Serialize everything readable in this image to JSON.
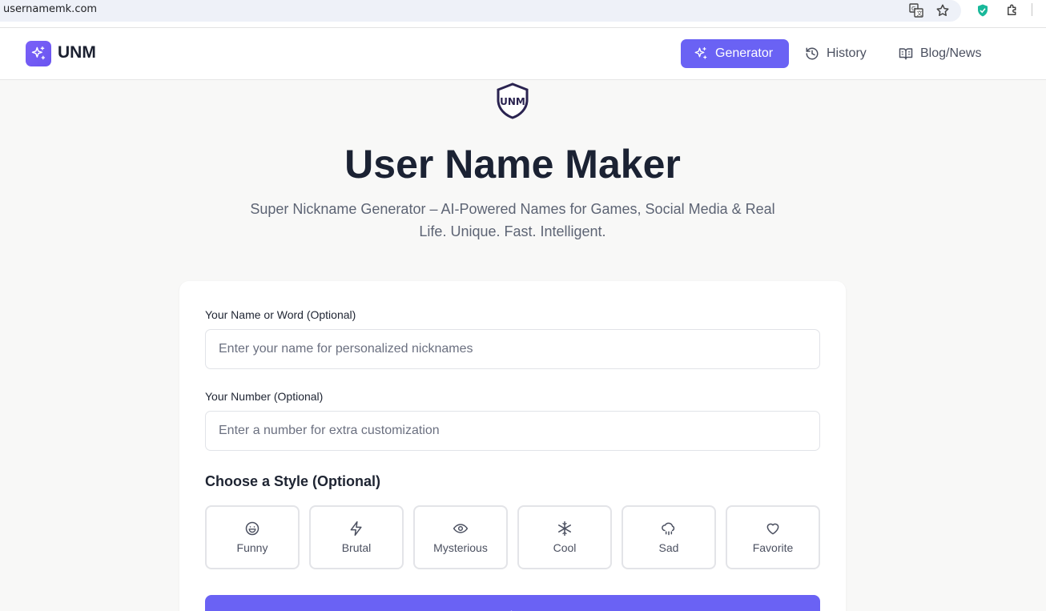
{
  "browser": {
    "url": "usernamemk.com",
    "icons": [
      "translate-icon",
      "bookmark-star-icon",
      "shield-extension-icon",
      "extensions-puzzle-icon"
    ]
  },
  "navbar": {
    "brand": "UNM",
    "items": [
      {
        "label": "Generator",
        "icon": "sparkles-icon",
        "active": true
      },
      {
        "label": "History",
        "icon": "history-icon",
        "active": false
      },
      {
        "label": "Blog/News",
        "icon": "book-open-icon",
        "active": false
      }
    ]
  },
  "hero": {
    "logo_text": "UNM",
    "title": "User Name Maker",
    "subtitle": "Super Nickname Generator – AI-Powered Names for Games, Social Media & Real Life. Unique. Fast. Intelligent."
  },
  "form": {
    "name_label": "Your Name or Word (Optional)",
    "name_placeholder": "Enter your name for personalized nicknames",
    "number_label": "Your Number (Optional)",
    "number_placeholder": "Enter a number for extra customization",
    "style_title": "Choose a Style (Optional)",
    "styles": [
      {
        "label": "Funny",
        "icon": "smile-icon"
      },
      {
        "label": "Brutal",
        "icon": "lightning-icon"
      },
      {
        "label": "Mysterious",
        "icon": "eye-icon"
      },
      {
        "label": "Cool",
        "icon": "snowflake-icon"
      },
      {
        "label": "Sad",
        "icon": "cloud-rain-icon"
      },
      {
        "label": "Favorite",
        "icon": "heart-icon"
      }
    ]
  },
  "colors": {
    "accent": "#6a62f4",
    "background": "#f8f8f7",
    "card": "#ffffff",
    "text_dark": "#1b2233",
    "text_muted": "#5d6474"
  }
}
